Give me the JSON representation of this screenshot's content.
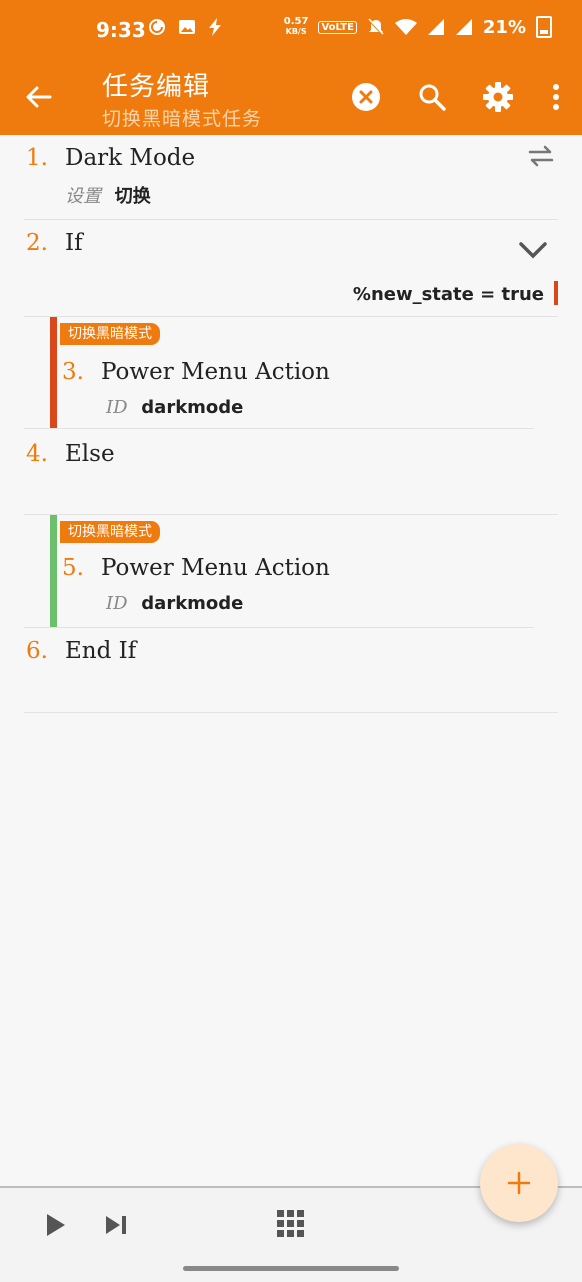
{
  "status": {
    "time": "9:33",
    "net_speed_value": "0.57",
    "net_speed_unit": "KB/S",
    "volte": "VoLTE",
    "battery": "21%"
  },
  "appbar": {
    "title": "任务编辑",
    "subtitle": "切换黑暗模式任务"
  },
  "actions": [
    {
      "num": "1.",
      "name": "Dark Mode",
      "param_label": "设置",
      "param_value": "切换"
    },
    {
      "num": "2.",
      "name": "If",
      "condition": "%new_state = true"
    },
    {
      "num": "3.",
      "name": "Power Menu Action",
      "block_label": "切换黑暗模式",
      "param_label": "ID",
      "param_value": "darkmode"
    },
    {
      "num": "4.",
      "name": "Else"
    },
    {
      "num": "5.",
      "name": "Power Menu Action",
      "block_label": "切换黑暗模式",
      "param_label": "ID",
      "param_value": "darkmode"
    },
    {
      "num": "6.",
      "name": "End If"
    }
  ],
  "colors": {
    "accent": "#ef7b0e",
    "if_bar": "#d9481b",
    "else_bar": "#6cbf6c"
  },
  "icons": [
    "back-arrow-icon",
    "cancel-circle-icon",
    "search-icon",
    "settings-gear-icon",
    "more-vert-icon",
    "swap-icon",
    "chevron-down-icon",
    "play-icon",
    "skip-next-icon",
    "grid-icon",
    "plus-icon"
  ]
}
